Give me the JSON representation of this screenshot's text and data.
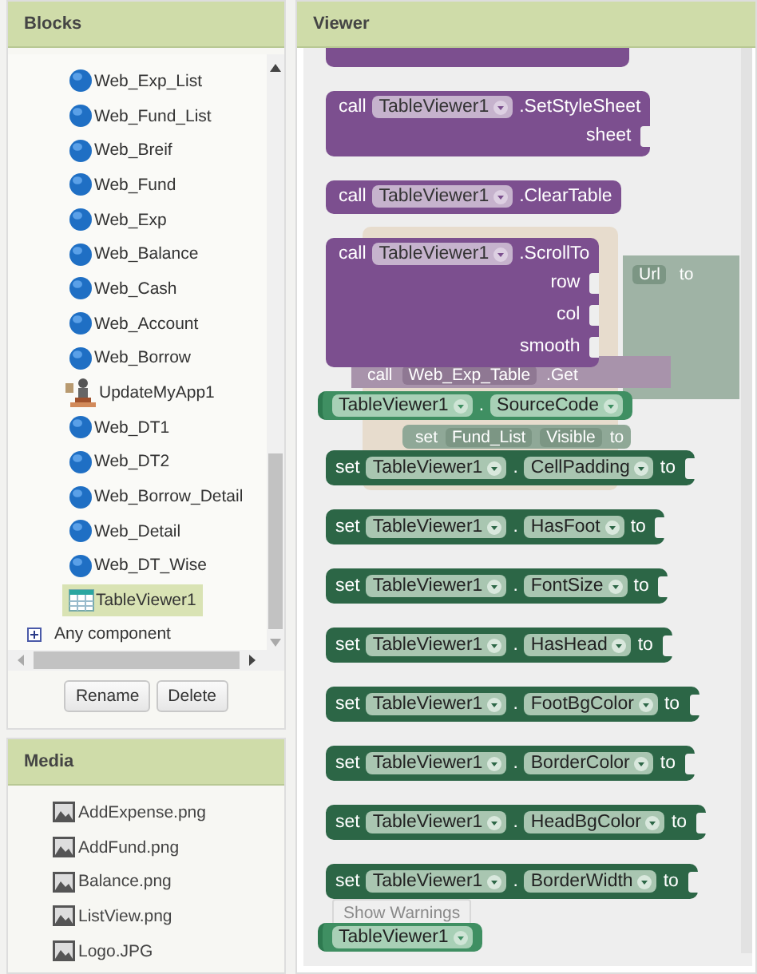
{
  "blocks_panel": {
    "title": "Blocks",
    "items": [
      {
        "label": "Web_Exp_List",
        "kind": "web",
        "selected": false
      },
      {
        "label": "Web_Fund_List",
        "kind": "web",
        "selected": false
      },
      {
        "label": "Web_Breif",
        "kind": "web",
        "selected": false
      },
      {
        "label": "Web_Fund",
        "kind": "web",
        "selected": false
      },
      {
        "label": "Web_Exp",
        "kind": "web",
        "selected": false
      },
      {
        "label": "Web_Balance",
        "kind": "web",
        "selected": false
      },
      {
        "label": "Web_Cash",
        "kind": "web",
        "selected": false
      },
      {
        "label": "Web_Account",
        "kind": "web",
        "selected": false
      },
      {
        "label": "Web_Borrow",
        "kind": "web",
        "selected": false
      },
      {
        "label": "UpdateMyApp1",
        "kind": "updater",
        "selected": false
      },
      {
        "label": "Web_DT1",
        "kind": "web",
        "selected": false
      },
      {
        "label": "Web_DT2",
        "kind": "web",
        "selected": false
      },
      {
        "label": "Web_Borrow_Detail",
        "kind": "web",
        "selected": false
      },
      {
        "label": "Web_Detail",
        "kind": "web",
        "selected": false
      },
      {
        "label": "Web_DT_Wise",
        "kind": "web",
        "selected": false
      },
      {
        "label": "TableViewer1",
        "kind": "table",
        "selected": true
      }
    ],
    "any_component": {
      "label": "Any component",
      "expanded": false
    },
    "buttons": [
      "Rename",
      "Delete"
    ]
  },
  "media_panel": {
    "title": "Media",
    "files": [
      "AddExpense.png",
      "AddFund.png",
      "Balance.png",
      "ListView.png",
      "Logo.JPG"
    ]
  },
  "viewer": {
    "title": "Viewer",
    "background_blocks": [
      {
        "kind": "event"
      },
      {
        "kind": "socket",
        "chip": "Url",
        "word": "to"
      },
      {
        "kind": "call",
        "keyword": "call",
        "component": "Web_Exp_Table",
        "method": ".Get"
      },
      {
        "kind": "set",
        "keyword": "set",
        "component": "Fund_List",
        "property": "Visible",
        "word": "to"
      }
    ],
    "show_warnings": "Show Warnings",
    "blocks": [
      {
        "kind": "partial"
      },
      {
        "kind": "call",
        "keyword": "call",
        "component": "TableViewer1",
        "method": ".SetStyleSheet",
        "args": [
          "sheet"
        ]
      },
      {
        "kind": "call",
        "keyword": "call",
        "component": "TableViewer1",
        "method": ".ClearTable"
      },
      {
        "kind": "call",
        "keyword": "call",
        "component": "TableViewer1",
        "method": ".ScrollTo",
        "args": [
          "row",
          "col",
          "smooth"
        ]
      },
      {
        "kind": "getter",
        "component": "TableViewer1",
        "separator": ".",
        "property": "SourceCode"
      },
      {
        "kind": "set",
        "keyword": "set",
        "component": "TableViewer1",
        "separator": ".",
        "property": "CellPadding",
        "word": "to"
      },
      {
        "kind": "set",
        "keyword": "set",
        "component": "TableViewer1",
        "separator": ".",
        "property": "HasFoot",
        "word": "to"
      },
      {
        "kind": "set",
        "keyword": "set",
        "component": "TableViewer1",
        "separator": ".",
        "property": "FontSize",
        "word": "to"
      },
      {
        "kind": "set",
        "keyword": "set",
        "component": "TableViewer1",
        "separator": ".",
        "property": "HasHead",
        "word": "to"
      },
      {
        "kind": "set",
        "keyword": "set",
        "component": "TableViewer1",
        "separator": ".",
        "property": "FootBgColor",
        "word": "to"
      },
      {
        "kind": "set",
        "keyword": "set",
        "component": "TableViewer1",
        "separator": ".",
        "property": "BorderColor",
        "word": "to"
      },
      {
        "kind": "set",
        "keyword": "set",
        "component": "TableViewer1",
        "separator": ".",
        "property": "HeadBgColor",
        "word": "to"
      },
      {
        "kind": "set",
        "keyword": "set",
        "component": "TableViewer1",
        "separator": ".",
        "property": "BorderWidth",
        "word": "to"
      },
      {
        "kind": "getter",
        "component": "TableViewer1"
      }
    ]
  }
}
